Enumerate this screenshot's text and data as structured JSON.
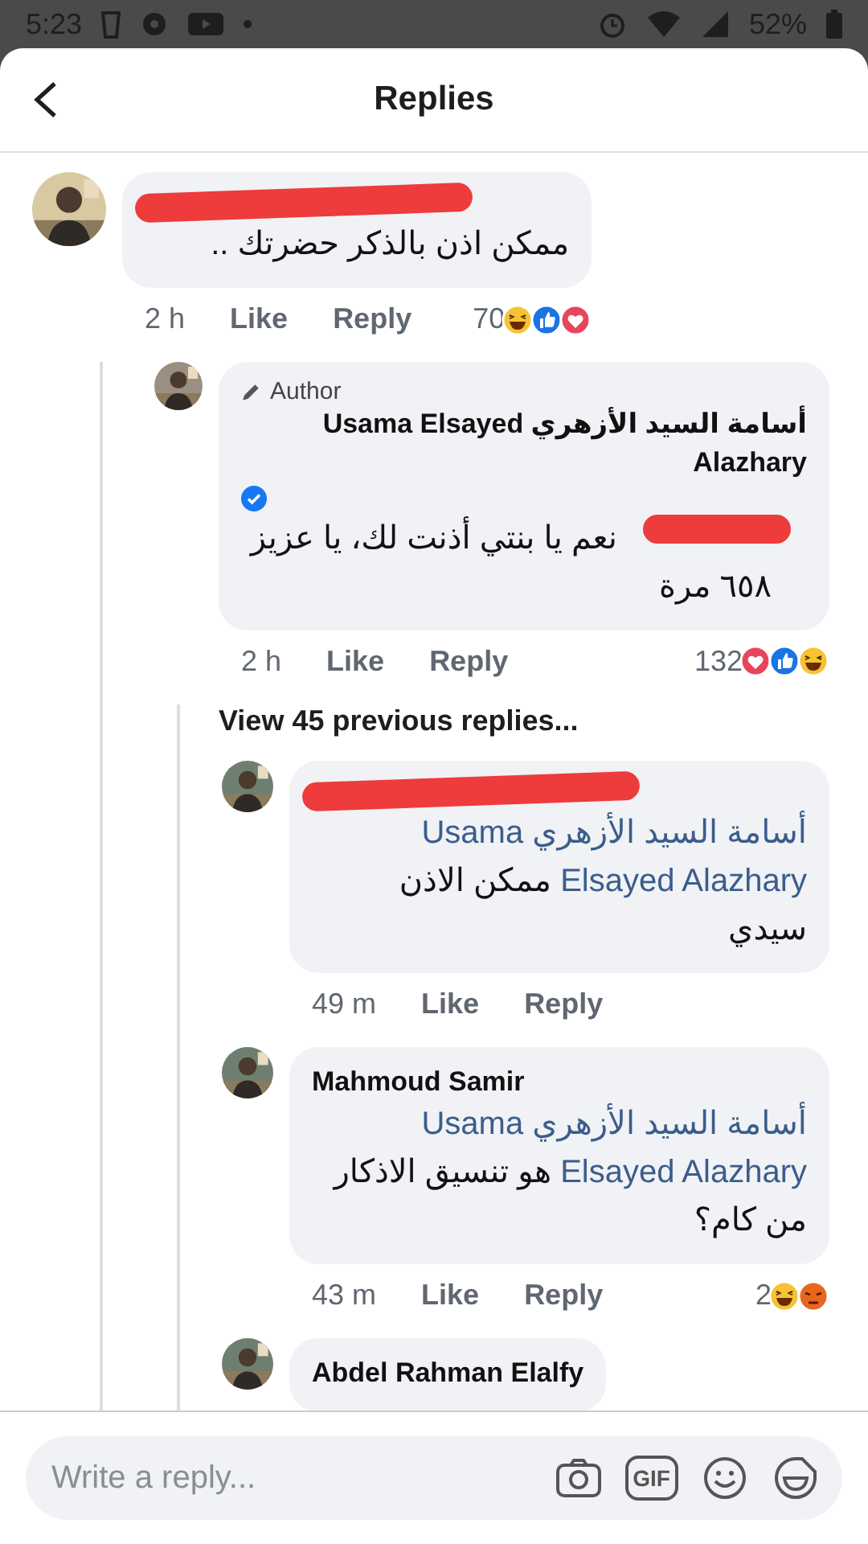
{
  "status_bar": {
    "time": "5:23",
    "battery": "52%"
  },
  "header": {
    "title": "Replies"
  },
  "comments": [
    {
      "kind": "comment",
      "name_redacted": true,
      "text": [
        {
          "kind": "plain",
          "text": "ممكن اذن بالذكر حضرتك .."
        }
      ],
      "time": "2 h",
      "like": "Like",
      "reply": "Reply",
      "reaction_count": "70",
      "reactions": [
        {
          "kind": "haha"
        },
        {
          "kind": "like"
        },
        {
          "kind": "love"
        }
      ],
      "children": [
        {
          "kind": "comment",
          "badge": "Author",
          "name": "أسامة السيد الأزهري Usama Elsayed Alazhary",
          "verified": true,
          "text_redacted": true,
          "text": [
            {
              "kind": "plain",
              "text": "نعم يا بنتي أذنت لك، يا عزيز ٦٥٨ مرة"
            }
          ],
          "time": "2 h",
          "like": "Like",
          "reply": "Reply",
          "reaction_count": "132",
          "reactions": [
            {
              "kind": "love"
            },
            {
              "kind": "like"
            },
            {
              "kind": "haha"
            }
          ],
          "children": [
            {
              "kind": "view_more",
              "label": "View 45 previous replies..."
            },
            {
              "kind": "comment",
              "name_redacted": true,
              "text": [
                {
                  "kind": "mention",
                  "text": "أسامة السيد الأزهري Usama Elsayed Alazhary"
                },
                {
                  "kind": "plain",
                  "text": "ممكن الاذن سيدي"
                }
              ],
              "time": "49 m",
              "like": "Like",
              "reply": "Reply"
            },
            {
              "kind": "comment",
              "name": "Mahmoud Samir",
              "text": [
                {
                  "kind": "mention",
                  "text": "أسامة السيد الأزهري Usama Elsayed Alazhary"
                },
                {
                  "kind": "plain",
                  "text": "هو تنسيق الاذكار من كام؟"
                }
              ],
              "time": "43 m",
              "like": "Like",
              "reply": "Reply",
              "reaction_count": "2",
              "reactions": [
                {
                  "kind": "haha"
                },
                {
                  "kind": "angry"
                }
              ]
            },
            {
              "kind": "comment",
              "name": "Abdel Rahman Elalfy"
            }
          ]
        }
      ]
    }
  ],
  "composer": {
    "placeholder": "Write a reply...",
    "gif_label": "GIF"
  }
}
